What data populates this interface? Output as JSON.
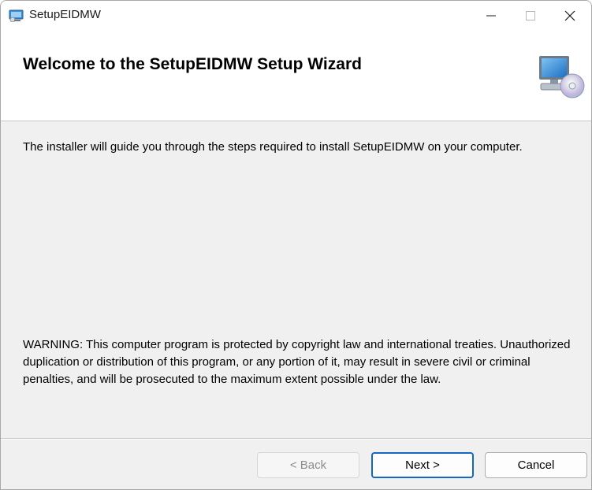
{
  "window": {
    "title": "SetupEIDMW"
  },
  "header": {
    "title": "Welcome to the SetupEIDMW Setup Wizard"
  },
  "content": {
    "intro": "The installer will guide you through the steps required to install SetupEIDMW on your computer.",
    "warning": "WARNING: This computer program is protected by copyright law and international treaties. Unauthorized duplication or distribution of this program, or any portion of it, may result in severe civil or criminal penalties, and will be prosecuted to the maximum extent possible under the law."
  },
  "buttons": {
    "back": "< Back",
    "next": "Next >",
    "cancel": "Cancel"
  },
  "colors": {
    "default_button_border": "#1467c3",
    "dialog_background": "#f0f0f0"
  },
  "icons": {
    "app": "installer-icon",
    "header": "computer-disc-icon",
    "minimize": "minimize-icon",
    "maximize": "maximize-icon",
    "close": "close-icon"
  }
}
